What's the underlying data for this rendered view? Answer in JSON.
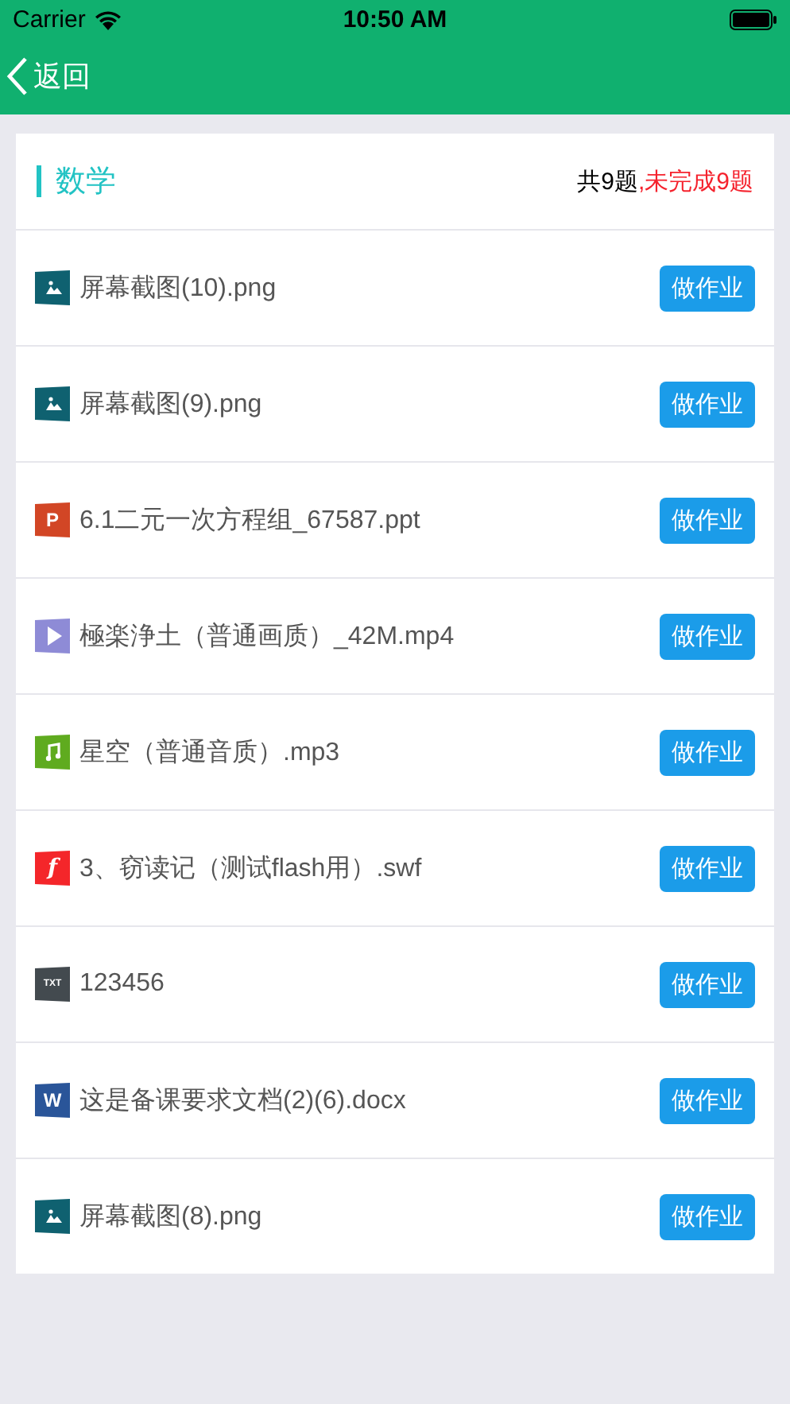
{
  "status_bar": {
    "carrier": "Carrier",
    "time": "10:50 AM"
  },
  "nav": {
    "back_label": "返回"
  },
  "subject": {
    "title": "数学",
    "total": "共9题",
    "pending": ",未完成9题"
  },
  "files": [
    {
      "kind": "image",
      "name": "屏幕截图(10).png",
      "action": "做作业"
    },
    {
      "kind": "image",
      "name": "屏幕截图(9).png",
      "action": "做作业"
    },
    {
      "kind": "ppt",
      "icon_label": "P",
      "name": "6.1二元一次方程组_67587.ppt",
      "action": "做作业"
    },
    {
      "kind": "video",
      "name": "極楽浄土（普通画质）_42M.mp4",
      "action": "做作业"
    },
    {
      "kind": "audio",
      "name": "星空（普通音质）.mp3",
      "action": "做作业"
    },
    {
      "kind": "flash",
      "icon_label": "f",
      "name": "3、窃读记（测试flash用）.swf",
      "action": "做作业"
    },
    {
      "kind": "txt",
      "icon_label": "TXT",
      "name": "123456",
      "action": "做作业"
    },
    {
      "kind": "word",
      "icon_label": "W",
      "name": "这是备课要求文档(2)(6).docx",
      "action": "做作业"
    },
    {
      "kind": "image",
      "name": "屏幕截图(8).png",
      "action": "做作业"
    }
  ]
}
